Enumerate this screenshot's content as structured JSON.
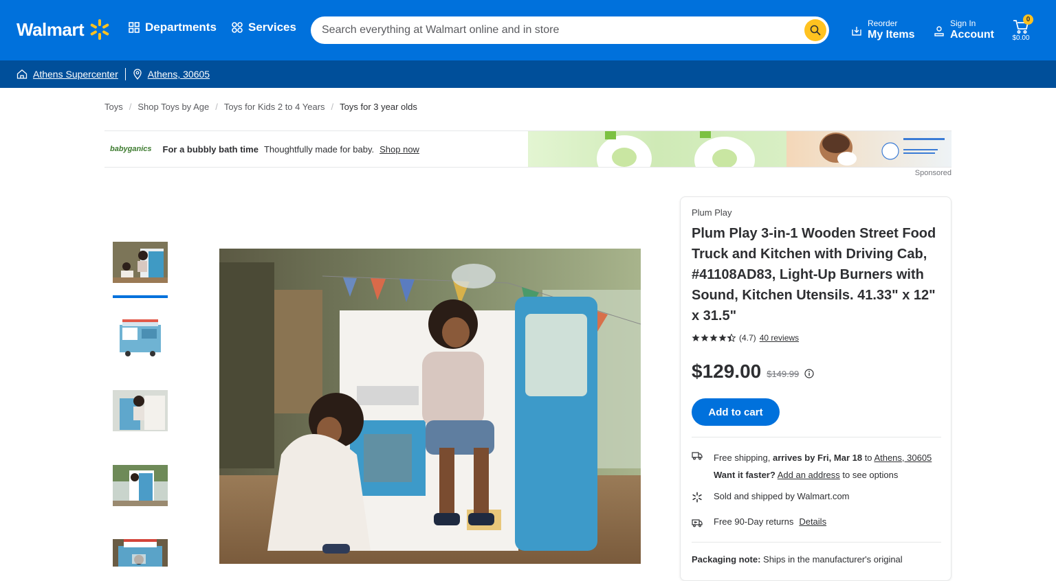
{
  "header": {
    "logo_text": "Walmart",
    "departments_label": "Departments",
    "services_label": "Services",
    "search_placeholder": "Search everything at Walmart online and in store",
    "reorder_small": "Reorder",
    "reorder_big": "My Items",
    "signin_small": "Sign In",
    "signin_big": "Account",
    "cart_count": "0",
    "cart_total": "$0.00",
    "colors": {
      "brand_blue": "#0071dc",
      "dark_blue": "#004f9a",
      "spark_yellow": "#ffc220"
    }
  },
  "location_bar": {
    "store": "Athens Supercenter",
    "zip": "Athens, 30605"
  },
  "breadcrumb": {
    "items": [
      "Toys",
      "Shop Toys by Age",
      "Toys for Kids 2 to 4 Years"
    ],
    "current": "Toys for 3 year olds"
  },
  "ad": {
    "brand": "babyganics",
    "headline": "For a bubbly bath time",
    "subtext": "Thoughtfully made for baby.",
    "link": "Shop now",
    "sponsored": "Sponsored"
  },
  "product": {
    "brand": "Plum Play",
    "title": "Plum Play 3-in-1 Wooden Street Food Truck and Kitchen with Driving Cab, #41108AD83, Light-Up Burners with Sound, Kitchen Utensils. 41.33\" x 12\" x 31.5\"",
    "rating_value": 4.7,
    "rating_text": "(4.7)",
    "reviews": "40 reviews",
    "price": "$129.00",
    "was_price": "$149.99",
    "add_to_cart": "Add to cart",
    "thumbnails_count": 5,
    "active_thumbnail": 1
  },
  "fulfillment": {
    "shipping_prefix": "Free shipping, ",
    "shipping_bold": "arrives by Fri, Mar 18",
    "shipping_to": " to ",
    "shipping_zip": "Athens, 30605",
    "faster_bold": "Want it faster?",
    "faster_link": "Add an address",
    "faster_suffix": " to see options",
    "sold_by": "Sold and shipped by Walmart.com",
    "returns": "Free 90-Day returns",
    "returns_link": "Details",
    "packaging_label": "Packaging note:",
    "packaging_text": " Ships in the manufacturer's original"
  }
}
